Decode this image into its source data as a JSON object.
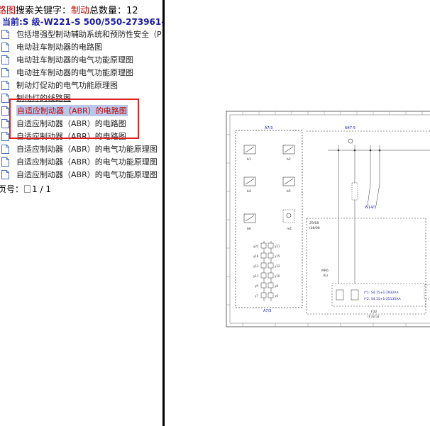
{
  "header": {
    "prefix": "路图",
    "keyword_label": "搜索关键字：",
    "keyword": "制动",
    "total_label": "总数量：",
    "total": "12"
  },
  "current": "当前:S 级-W221-S 500/550-273961-",
  "items": [
    {
      "label": "包括增强型制动辅助系统和预防性安全（P",
      "selected": false
    },
    {
      "label": "电动驻车制动器的电路图",
      "selected": false
    },
    {
      "label": "电动驻车制动器的电气功能原理图",
      "selected": false
    },
    {
      "label": "电动驻车制动器的电气功能原理图",
      "selected": false
    },
    {
      "label": "制动灯促动的电气功能原理图",
      "selected": false
    },
    {
      "label": "制动灯的线路图",
      "selected": false
    },
    {
      "label": "自适应制动器（ABR）的电路图",
      "selected": true
    },
    {
      "label": "自适应制动器（ABR）的电路图",
      "selected": false
    },
    {
      "label": "自适应制动器（ABR）的电路图",
      "selected": false
    },
    {
      "label": "自适应制动器（ABR）的电气功能原理图",
      "selected": false
    },
    {
      "label": "自适应制动器（ABR）的电气功能原理图",
      "selected": false
    },
    {
      "label": "自适应制动器（ABR）的电气功能原理图",
      "selected": false
    }
  ],
  "pager": {
    "label": "页号：",
    "value": "1 / 1"
  },
  "diagram": {
    "labels": {
      "a7_3_top": "A7/3",
      "a7_3_bottom": "A7/3",
      "n47_5": "N47-5",
      "w14_3": "W14/3",
      "z3_box": "Z9/08",
      "z3_box_sub": "(08/08",
      "mr6": "MR6",
      "mr6_sub": "(G)",
      "f32": "F32",
      "f32_sub": "(F32/3)",
      "leg1": "(*1: S4.15+1-2932AA",
      "leg2": "(*2: S4.15+1-2513SAA",
      "b1": "b1",
      "b2": "b2",
      "b4": "b4",
      "b5": "b5",
      "b6": "b6",
      "m1": "m1",
      "y22": "y22",
      "y21": "y21",
      "y16": "y16",
      "y15": "y15",
      "y13": "y13",
      "y12": "y12",
      "y11": "y11",
      "y10": "y10",
      "y9": "y9",
      "y8": "y8",
      "y7": "y7",
      "y6": "y6"
    },
    "accent_color": "#1a1aa8",
    "highlight_color": "#e02020"
  }
}
